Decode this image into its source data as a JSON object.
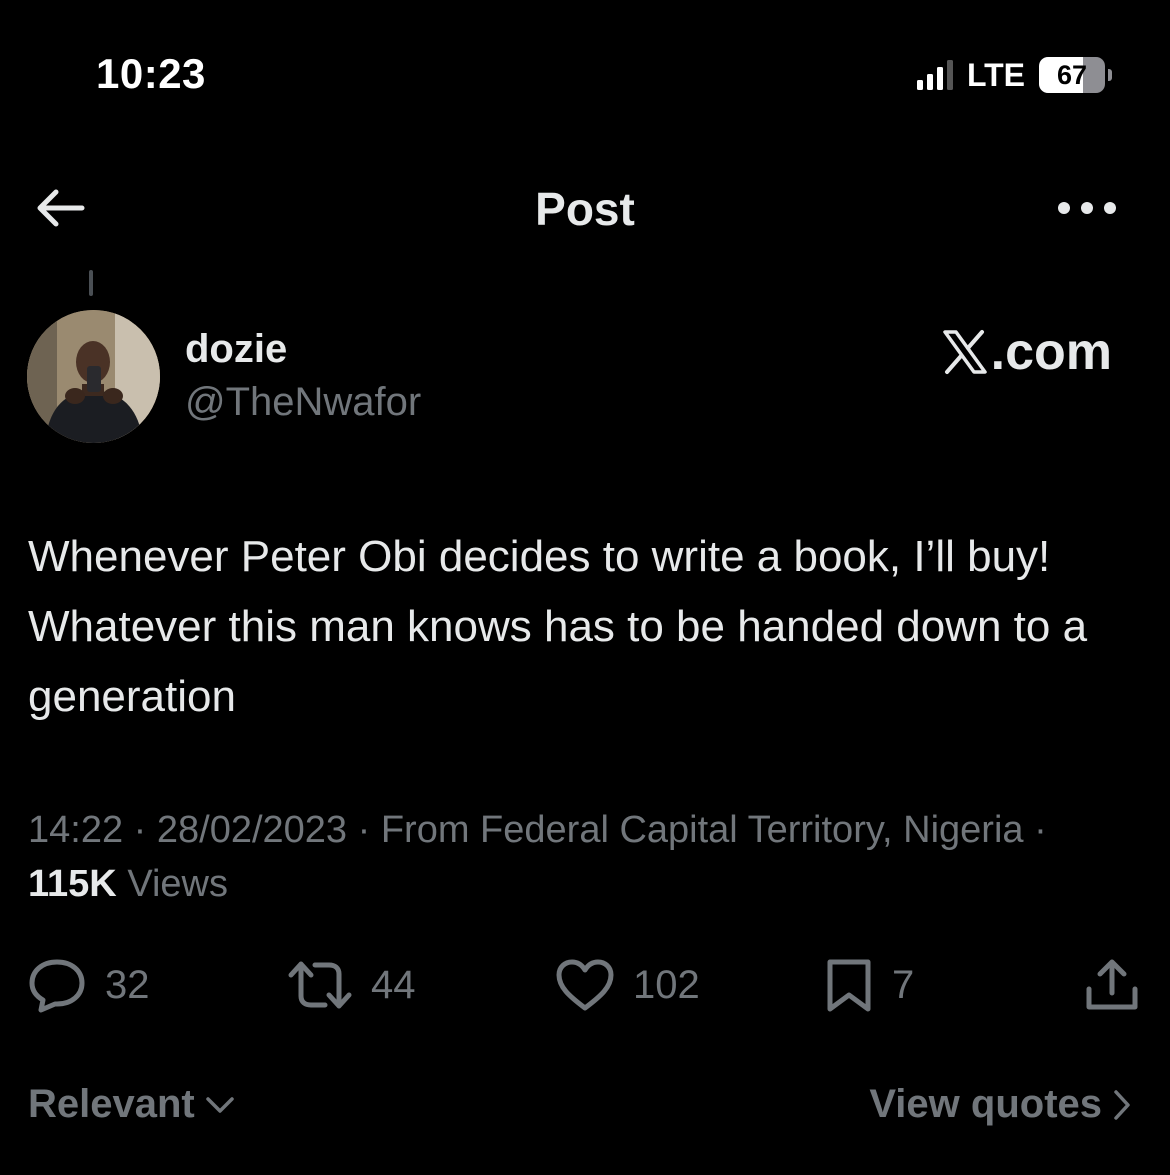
{
  "status_bar": {
    "time": "10:23",
    "network": "LTE",
    "battery_percent": "67",
    "signal_bars_active": 3,
    "signal_bars_total": 4
  },
  "header": {
    "title": "Post",
    "back_icon": "arrow-left-icon",
    "more_icon": "more-horizontal-icon"
  },
  "author": {
    "name": "dozie",
    "handle": "@TheNwafor",
    "brand": ".com"
  },
  "post": {
    "text": "Whenever Peter Obi decides to write a book, I’ll buy! Whatever this man knows has to be handed down to a generation",
    "time": "14:22",
    "date": "28/02/2023",
    "location": "From Federal Capital Territory, Nigeria",
    "views_count": "115K",
    "views_label": "Views",
    "separator": "·"
  },
  "actions": {
    "replies": "32",
    "reposts": "44",
    "likes": "102",
    "bookmarks": "7"
  },
  "footer": {
    "sort_label": "Relevant",
    "quotes_label": "View quotes"
  },
  "colors": {
    "background": "#000000",
    "text_primary": "#e7e9ea",
    "text_secondary": "#71767b"
  }
}
